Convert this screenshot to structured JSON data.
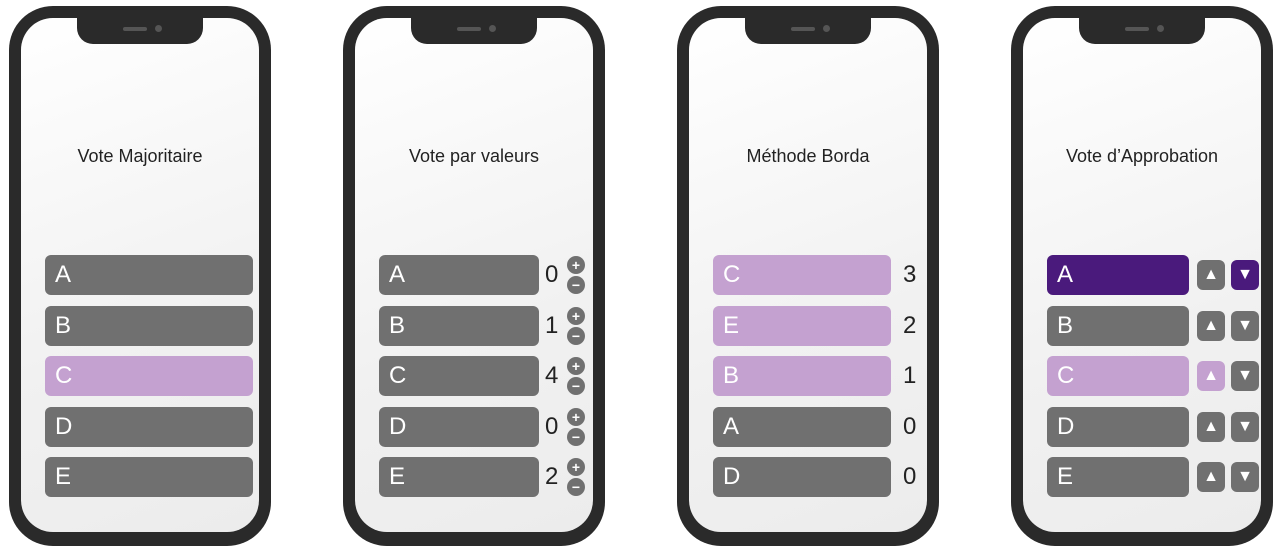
{
  "colors": {
    "gray": "#707070",
    "light_purple": "#c4a1d0",
    "dark_purple": "#4a1a7c",
    "frame": "#2a2a2a"
  },
  "phones": [
    {
      "title": "Vote Majoritaire",
      "rows": [
        {
          "label": "A",
          "state": "default"
        },
        {
          "label": "B",
          "state": "default"
        },
        {
          "label": "C",
          "state": "selected"
        },
        {
          "label": "D",
          "state": "default"
        },
        {
          "label": "E",
          "state": "default"
        }
      ]
    },
    {
      "title": "Vote par valeurs",
      "rows": [
        {
          "label": "A",
          "value": "0"
        },
        {
          "label": "B",
          "value": "1"
        },
        {
          "label": "C",
          "value": "4"
        },
        {
          "label": "D",
          "value": "0"
        },
        {
          "label": "E",
          "value": "2"
        }
      ],
      "icons": {
        "plus": "+",
        "minus": "−"
      }
    },
    {
      "title": "Méthode Borda",
      "rows": [
        {
          "label": "C",
          "value": "3",
          "state": "ranked"
        },
        {
          "label": "E",
          "value": "2",
          "state": "ranked"
        },
        {
          "label": "B",
          "value": "1",
          "state": "ranked"
        },
        {
          "label": "A",
          "value": "0",
          "state": "default"
        },
        {
          "label": "D",
          "value": "0",
          "state": "default"
        }
      ]
    },
    {
      "title": "Vote d’Approbation",
      "rows": [
        {
          "label": "A",
          "state": "disapproved"
        },
        {
          "label": "B",
          "state": "default"
        },
        {
          "label": "C",
          "state": "approved"
        },
        {
          "label": "D",
          "state": "default"
        },
        {
          "label": "E",
          "state": "default"
        }
      ],
      "icons": {
        "thumbs_up": "thumbs-up-icon",
        "thumbs_down": "thumbs-down-icon"
      }
    }
  ]
}
